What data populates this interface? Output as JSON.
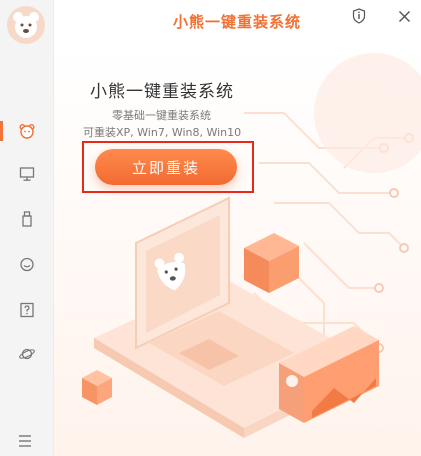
{
  "header": {
    "title": "小熊一键重装系统"
  },
  "main": {
    "headline": "小熊一键重装系统",
    "subtitle_1": "零基础一键重装系统",
    "subtitle_2": "可重装XP, Win7, Win8, Win10",
    "cta_label": "立即重装"
  },
  "sidebar": {
    "items": [
      {
        "name": "bear",
        "icon": "bear-icon",
        "active": true
      },
      {
        "name": "monitor",
        "icon": "monitor-icon",
        "active": false
      },
      {
        "name": "usb",
        "icon": "usb-drive-icon",
        "active": false
      },
      {
        "name": "chat",
        "icon": "chat-bubble-icon",
        "active": false
      },
      {
        "name": "help",
        "icon": "question-box-icon",
        "active": false
      },
      {
        "name": "planet",
        "icon": "planet-icon",
        "active": false
      }
    ]
  },
  "colors": {
    "accent": "#f27135",
    "highlight_frame": "#e8281b",
    "sidebar_bg": "#f4f4f4"
  }
}
